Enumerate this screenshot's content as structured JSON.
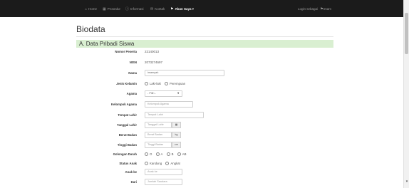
{
  "navbar": {
    "items": [
      {
        "icon": "home-icon",
        "glyph": "⌂",
        "label": "Home"
      },
      {
        "icon": "calendar-icon",
        "glyph": "▦",
        "label": "Prosedur"
      },
      {
        "icon": "info-icon",
        "glyph": "ⓘ",
        "label": "Informasi"
      },
      {
        "icon": "chat-icon",
        "glyph": "✉",
        "label": "Kontak"
      },
      {
        "icon": "user-icon",
        "glyph": "⚑",
        "label": "Akun Saya ▾"
      }
    ],
    "right_text": "Login sebagai",
    "right_user": "Imam"
  },
  "page": {
    "title": "Biodata",
    "section_title": "A. Data Pribadi Siswa"
  },
  "form": {
    "nomor_peserta_label": "Nomor Peserta",
    "nomor_peserta_value": "22140013",
    "nisn_label": "NISN",
    "nisn_value": "2073274697",
    "nama_label": "Nama",
    "nama_value": "imamyah",
    "jenis_kelamin_label": "Jenis Kelamin",
    "jenis_kelamin_options": [
      "Laki-laki",
      "Perempuan"
    ],
    "agama_label": "Agama",
    "agama_value": "- Pilih -",
    "kelompok_agama_label": "Kelompok Agama",
    "kelompok_agama_placeholder": "Kelompok Agama",
    "tempat_lahir_label": "Tempat Lahir",
    "tempat_lahir_placeholder": "Tempat Lahir",
    "tanggal_lahir_label": "Tanggal Lahir",
    "tanggal_lahir_placeholder": "Tanggal Lahir",
    "berat_badan_label": "Berat Badan",
    "berat_badan_placeholder": "Berat Badan",
    "berat_badan_unit": "kg",
    "tinggi_badan_label": "Tinggi Badan",
    "tinggi_badan_placeholder": "Tinggi Badan",
    "tinggi_badan_unit": "cm",
    "golongan_darah_label": "Golongan Darah",
    "golongan_darah_options": [
      "O",
      "A",
      "B",
      "AB"
    ],
    "status_anak_label": "Status Anak",
    "status_anak_options": [
      "Kandung",
      "Angkat"
    ],
    "anak_ke_label": "Anak ke",
    "anak_ke_placeholder": "Anak ke",
    "dari_label": "Dari",
    "dari_placeholder": "Jumlah Saudara"
  }
}
